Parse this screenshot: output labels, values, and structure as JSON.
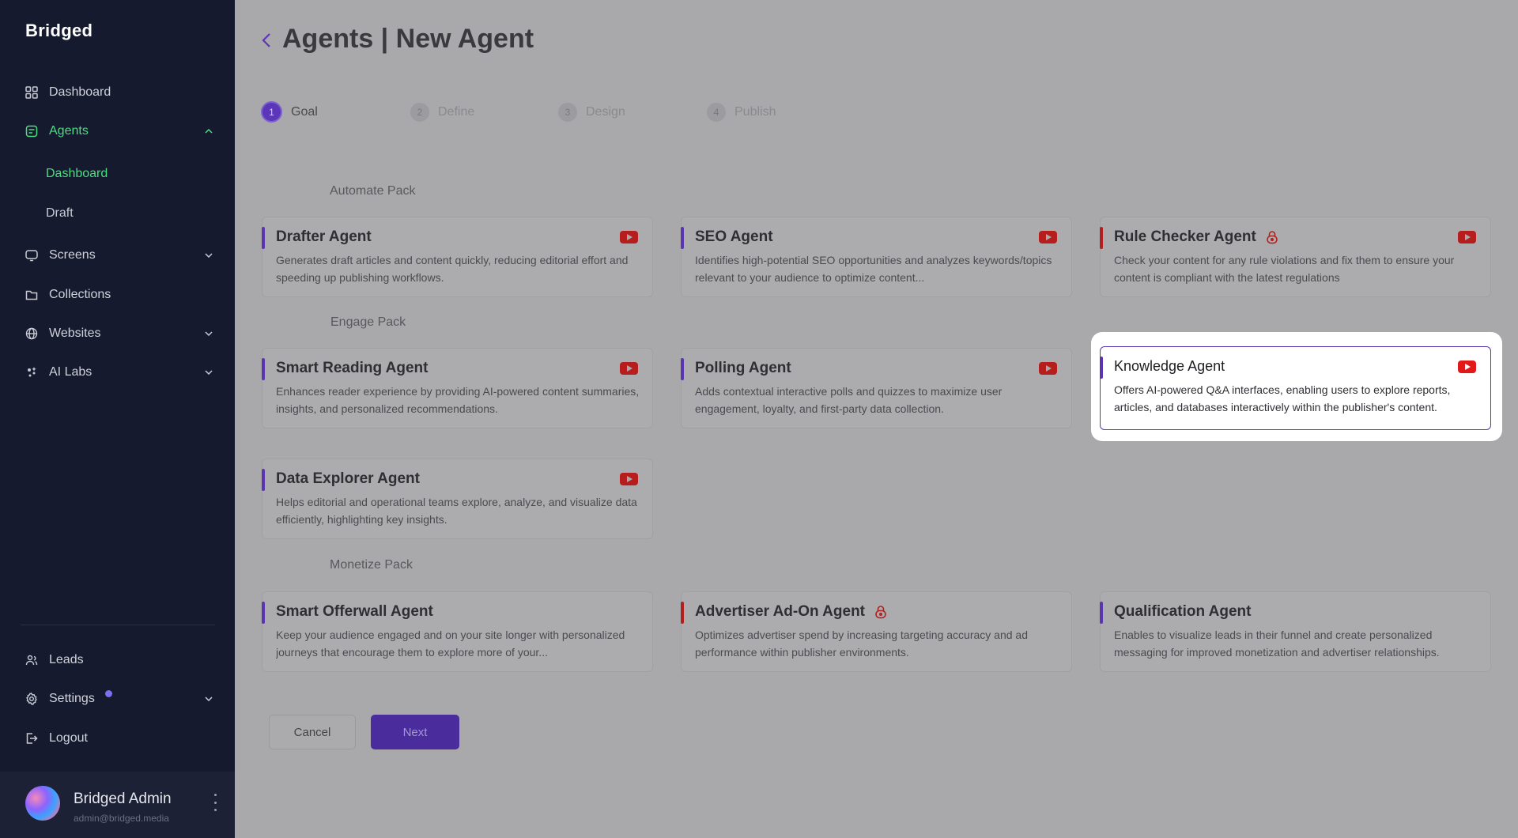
{
  "app": {
    "logo": "Bridged"
  },
  "sidebar": {
    "items": [
      {
        "label": "Dashboard",
        "icon": "grid-icon"
      },
      {
        "label": "Agents",
        "icon": "agents-icon",
        "active": true,
        "expanded": true
      },
      {
        "label": "Screens",
        "icon": "screen-icon"
      },
      {
        "label": "Collections",
        "icon": "folder-icon"
      },
      {
        "label": "Websites",
        "icon": "globe-icon"
      },
      {
        "label": "AI Labs",
        "icon": "ai-labs-icon"
      }
    ],
    "agents_sub": [
      {
        "label": "Dashboard",
        "active": true
      },
      {
        "label": "Draft"
      }
    ],
    "bottom": [
      {
        "label": "Leads",
        "icon": "leads-icon"
      },
      {
        "label": "Settings",
        "icon": "gear-icon"
      },
      {
        "label": "Logout",
        "icon": "logout-icon"
      }
    ],
    "user": {
      "name": "Bridged Admin",
      "email": "admin@bridged.media"
    }
  },
  "header": {
    "title": "Agents | New Agent"
  },
  "steps": [
    {
      "num": "1",
      "label": "Goal",
      "active": true
    },
    {
      "num": "2",
      "label": "Define"
    },
    {
      "num": "3",
      "label": "Design"
    },
    {
      "num": "4",
      "label": "Publish"
    }
  ],
  "packs": {
    "automate": {
      "title": "Automate Pack",
      "cards": [
        {
          "title": "Drafter Agent",
          "desc": "Generates draft articles and content quickly, reducing editorial effort and speeding up publishing workflows."
        },
        {
          "title": "SEO Agent",
          "desc": "Identifies high-potential SEO opportunities and analyzes keywords/topics relevant to your audience to optimize content..."
        },
        {
          "title": "Rule Checker Agent",
          "desc": "Check your content for any rule violations and fix them to ensure your content is compliant with the latest regulations"
        }
      ]
    },
    "engage": {
      "title": "Engage Pack",
      "cards": [
        {
          "title": "Smart Reading Agent",
          "desc": "Enhances reader experience by providing AI-powered content summaries, insights, and personalized recommendations."
        },
        {
          "title": "Polling Agent",
          "desc": "Adds contextual interactive polls and quizzes to maximize user engagement, loyalty, and first-party data collection."
        },
        {
          "title": "Knowledge Agent",
          "desc": "Offers AI-powered Q&A interfaces, enabling users to explore reports, articles, and databases interactively within the publisher's content."
        },
        {
          "title": "Data Explorer Agent",
          "desc": "Helps editorial and operational teams explore, analyze, and visualize data efficiently, highlighting key insights."
        }
      ]
    },
    "monetize": {
      "title": "Monetize Pack",
      "cards": [
        {
          "title": "Smart Offerwall Agent",
          "desc": "Keep your audience engaged and on your site longer with personalized journeys that encourage them to explore more of your..."
        },
        {
          "title": "Advertiser Ad-On Agent",
          "desc": "Optimizes advertiser spend by increasing targeting accuracy and ad performance within publisher environments."
        },
        {
          "title": "Qualification Agent",
          "desc": "Enables to visualize leads in their funnel and create personalized messaging for improved monetization and advertiser relationships."
        }
      ]
    }
  },
  "footer": {
    "cancel_label": "Cancel",
    "next_label": "Next"
  }
}
